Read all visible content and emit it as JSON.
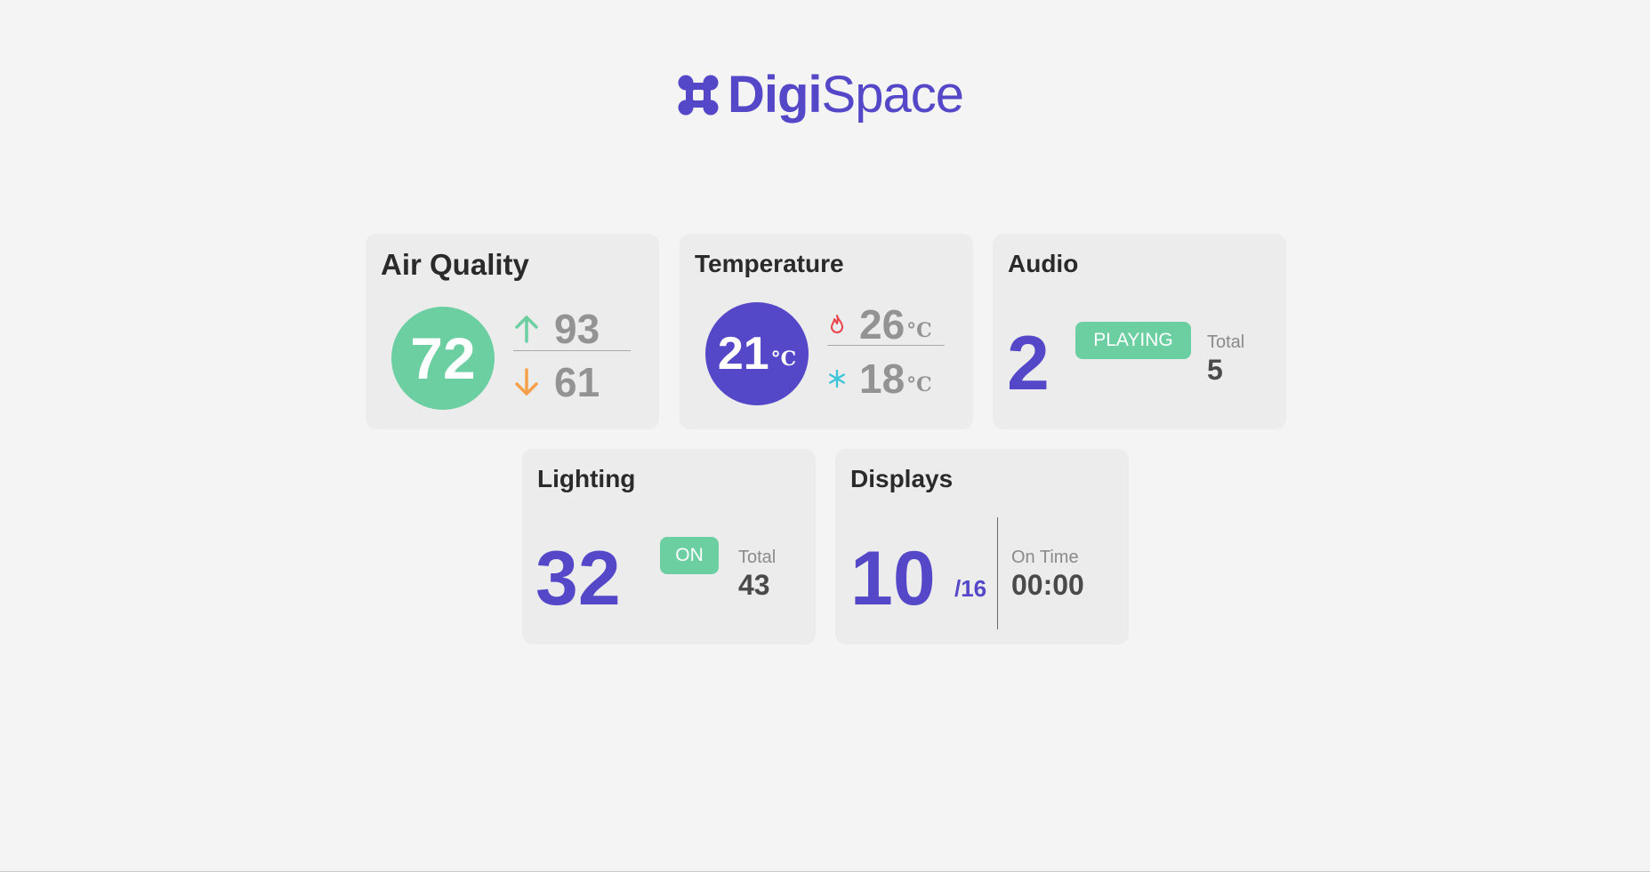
{
  "brand": {
    "name_bold": "Digi",
    "name_light": "Space",
    "logo_icon": "four-dots-logo-icon",
    "color": "#5447c8"
  },
  "colors": {
    "accent_purple": "#5447c8",
    "accent_green": "#6ccfa2",
    "arrow_down": "#f5a04a",
    "heat_icon": "#e8434a",
    "cool_icon": "#3cc6d8"
  },
  "air_quality": {
    "title": "Air Quality",
    "current": "72",
    "high": "93",
    "low": "61",
    "high_icon": "arrow-up-icon",
    "low_icon": "arrow-down-icon"
  },
  "temperature": {
    "title": "Temperature",
    "current": "21",
    "unit": "°C",
    "high": "26",
    "low": "18",
    "high_icon": "flame-icon",
    "low_icon": "snowflake-icon"
  },
  "audio": {
    "title": "Audio",
    "active": "2",
    "status": "PLAYING",
    "total_label": "Total",
    "total": "5"
  },
  "lighting": {
    "title": "Lighting",
    "active": "32",
    "status": "ON",
    "total_label": "Total",
    "total": "43"
  },
  "displays": {
    "title": "Displays",
    "active": "10",
    "of_total": "/16",
    "on_time_label": "On Time",
    "on_time": "00:00"
  }
}
